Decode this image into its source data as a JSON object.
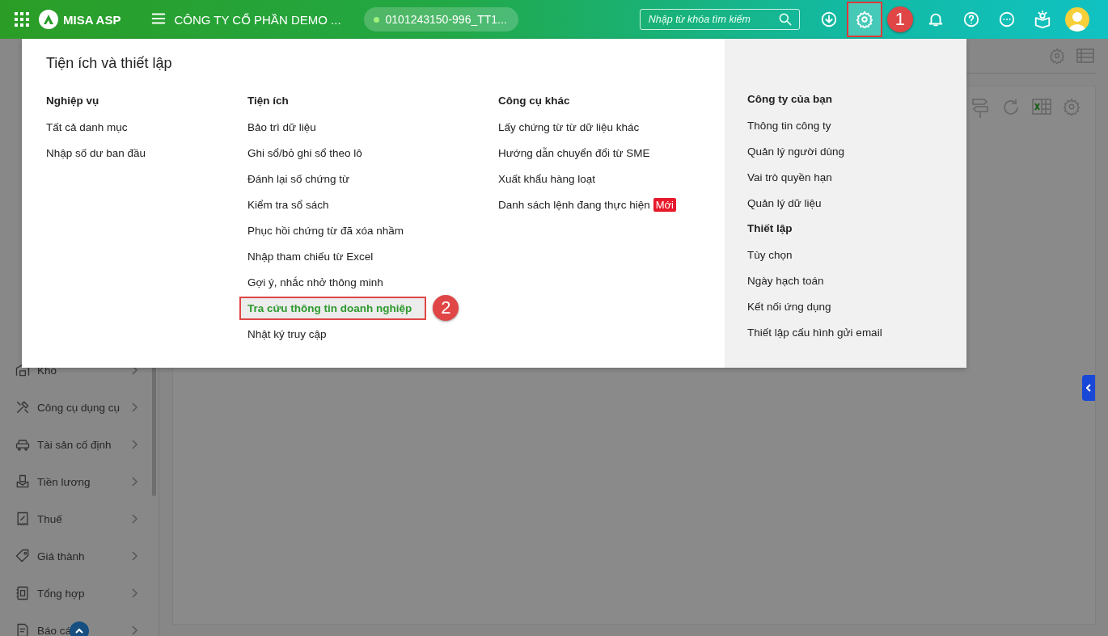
{
  "header": {
    "app_name": "MISA ASP",
    "company": "CÔNG TY CỔ PHẦN DEMO ...",
    "tax_code": "0101243150-996_TT1...",
    "search": {
      "placeholder": "Nhập từ khóa tìm kiếm"
    },
    "settings_marked": true
  },
  "sidebar": {
    "items": [
      {
        "label": "Kho"
      },
      {
        "label": "Công cụ dụng cụ"
      },
      {
        "label": "Tài sản cố định"
      },
      {
        "label": "Tiền lương"
      },
      {
        "label": "Thuế"
      },
      {
        "label": "Giá thành"
      },
      {
        "label": "Tổng hợp"
      },
      {
        "label": "Báo cá"
      }
    ]
  },
  "menu": {
    "title": "Tiện ích và thiết lập",
    "columns": [
      {
        "kind": "plain",
        "sections": [
          {
            "heading": "Nghiệp vụ",
            "items": [
              {
                "label": "Tất cả danh mục",
                "selected": false
              },
              {
                "label": "Nhập số dư ban đầu",
                "selected": false
              }
            ]
          }
        ]
      },
      {
        "kind": "plain",
        "sections": [
          {
            "heading": "Tiện ích",
            "items": [
              {
                "label": "Bảo trì dữ liệu",
                "selected": false
              },
              {
                "label": "Ghi sổ/bỏ ghi sổ theo lô",
                "selected": false
              },
              {
                "label": "Đánh lại số chứng từ",
                "selected": false
              },
              {
                "label": "Kiểm tra sổ sách",
                "selected": false
              },
              {
                "label": "Phục hồi chứng từ đã xóa nhầm",
                "selected": false
              },
              {
                "label": "Nhập tham chiếu từ Excel",
                "selected": false
              },
              {
                "label": "Gợi ý, nhắc nhở thông minh",
                "selected": false
              },
              {
                "label": "Tra cứu thông tin doanh nghiệp",
                "selected": true,
                "marked": true
              },
              {
                "label": "Nhật ký truy cập",
                "selected": false
              }
            ]
          }
        ]
      },
      {
        "kind": "plain",
        "sections": [
          {
            "heading": "Công cụ khác",
            "items": [
              {
                "label": "Lấy chứng từ từ dữ liệu khác",
                "selected": false
              },
              {
                "label": "Hướng dẫn chuyển đổi từ SME",
                "selected": false
              },
              {
                "label": "Xuất khẩu hàng loạt",
                "selected": false
              },
              {
                "label": "Danh sách lệnh đang thực hiện",
                "selected": false,
                "badge": "Mới"
              }
            ]
          }
        ]
      },
      {
        "kind": "shaded",
        "sections": [
          {
            "heading": "Công ty của bạn",
            "items": [
              {
                "label": "Thông tin công ty",
                "selected": false
              },
              {
                "label": "Quản lý người dùng",
                "selected": false
              },
              {
                "label": "Vai trò quyền hạn",
                "selected": false
              },
              {
                "label": "Quản lý dữ liệu",
                "selected": false
              }
            ]
          },
          {
            "heading": "Thiết lập",
            "items": [
              {
                "label": "Tùy chọn",
                "selected": false
              },
              {
                "label": "Ngày hạch toán",
                "selected": false
              },
              {
                "label": "Kết nối ứng dụng",
                "selected": false
              },
              {
                "label": "Thiết lập cấu hình gửi email",
                "selected": false
              }
            ]
          }
        ]
      }
    ]
  },
  "annotations": [
    {
      "label": "1"
    },
    {
      "label": "2"
    }
  ]
}
